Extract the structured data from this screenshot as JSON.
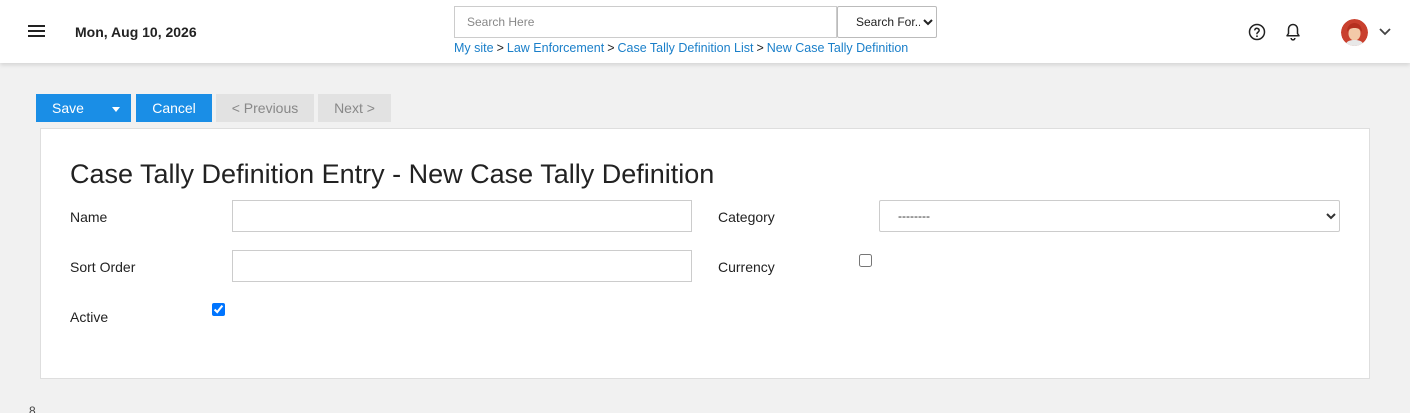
{
  "header": {
    "date": "Mon, Aug 10, 2026",
    "search": {
      "placeholder": "Search Here",
      "value": "",
      "scope_selected": "Search For..."
    },
    "breadcrumb": [
      {
        "label": "My site"
      },
      {
        "label": "Law Enforcement"
      },
      {
        "label": "Case Tally Definition List"
      },
      {
        "label": "New Case Tally Definition"
      }
    ],
    "breadcrumb_separator": ">",
    "icons": {
      "menu": "hamburger-menu-icon",
      "help": "help-circle-icon",
      "notifications": "bell-icon",
      "user": "avatar",
      "user_menu": "chevron-down-icon"
    }
  },
  "toolbar": {
    "save_label": "Save",
    "cancel_label": "Cancel",
    "previous_label": "< Previous",
    "next_label": "Next >"
  },
  "form": {
    "title": "Case Tally Definition Entry - New Case Tally Definition",
    "fields": {
      "name": {
        "label": "Name",
        "value": ""
      },
      "sort_order": {
        "label": "Sort Order",
        "value": ""
      },
      "active": {
        "label": "Active",
        "checked": true
      },
      "category": {
        "label": "Category",
        "selected": "--------"
      },
      "currency": {
        "label": "Currency",
        "checked": false
      }
    }
  },
  "footer_glyph": "8",
  "colors": {
    "accent": "#1a8ee6",
    "link": "#1a7fc9",
    "disabled_bg": "#e2e2e2",
    "page_bg": "#f1f1f1"
  }
}
